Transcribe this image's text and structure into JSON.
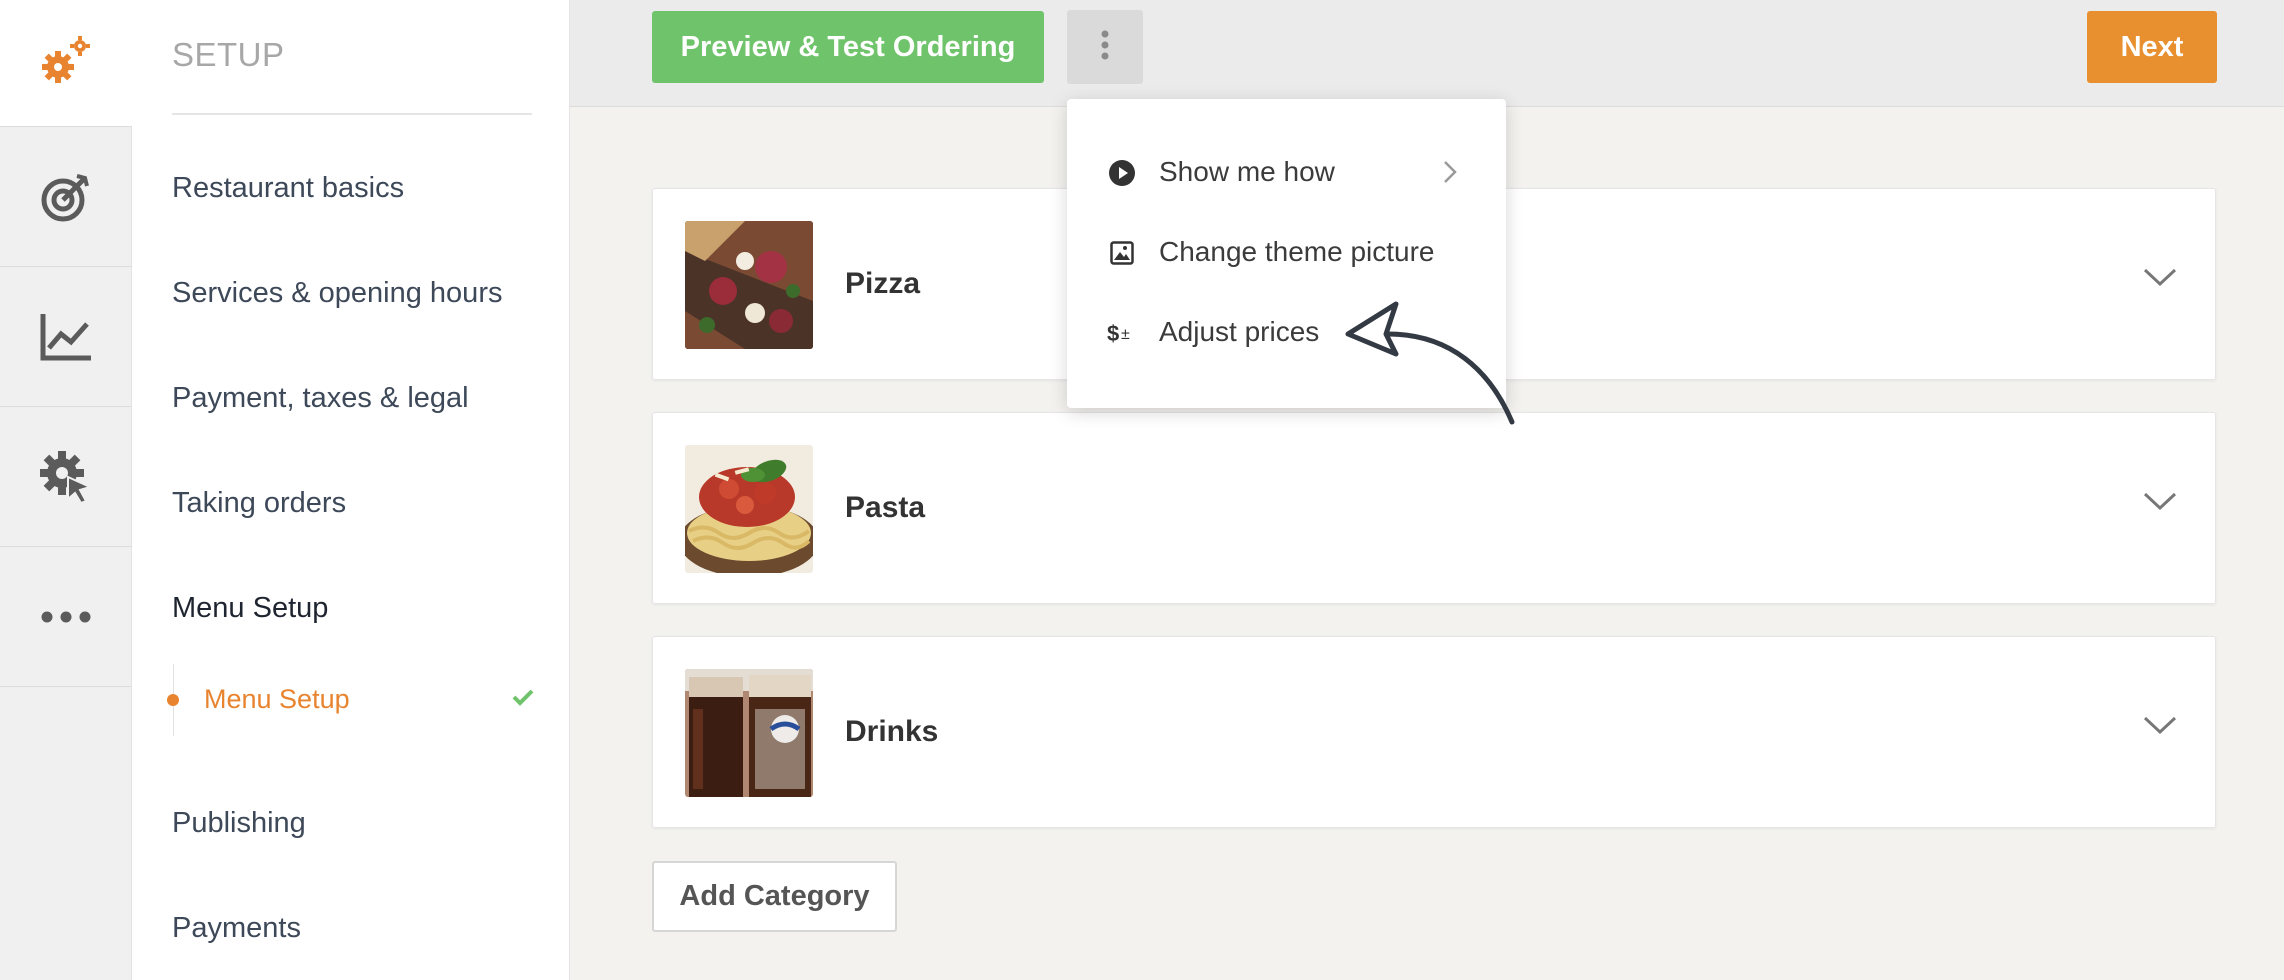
{
  "rail": {
    "logo_icon": "gears-icon",
    "items": [
      {
        "icon": "target-icon"
      },
      {
        "icon": "chart-line-icon"
      },
      {
        "icon": "gear-cursor-icon"
      },
      {
        "icon": "more-icon"
      }
    ]
  },
  "nav": {
    "title": "SETUP",
    "items": [
      {
        "label": "Restaurant basics"
      },
      {
        "label": "Services & opening hours"
      },
      {
        "label": "Payment, taxes & legal"
      },
      {
        "label": "Taking orders"
      },
      {
        "label": "Menu Setup"
      },
      {
        "label": "Publishing"
      },
      {
        "label": "Payments"
      }
    ],
    "sub_item": {
      "label": "Menu Setup",
      "status": "checked"
    }
  },
  "toolbar": {
    "preview_label": "Preview & Test Ordering",
    "next_label": "Next"
  },
  "menu": {
    "items": [
      {
        "label": "Show me how",
        "icon": "play-circle-icon"
      },
      {
        "label": "Change theme picture",
        "icon": "image-icon"
      },
      {
        "label": "Adjust prices",
        "icon": "dollar-plus-minus-icon"
      }
    ]
  },
  "categories": [
    {
      "name": "Pizza"
    },
    {
      "name": "Pasta"
    },
    {
      "name": "Drinks"
    }
  ],
  "add_category_label": "Add Category",
  "colors": {
    "accent": "#e8842f",
    "primary_green": "#6fc46b",
    "next_orange": "#e8902f"
  }
}
